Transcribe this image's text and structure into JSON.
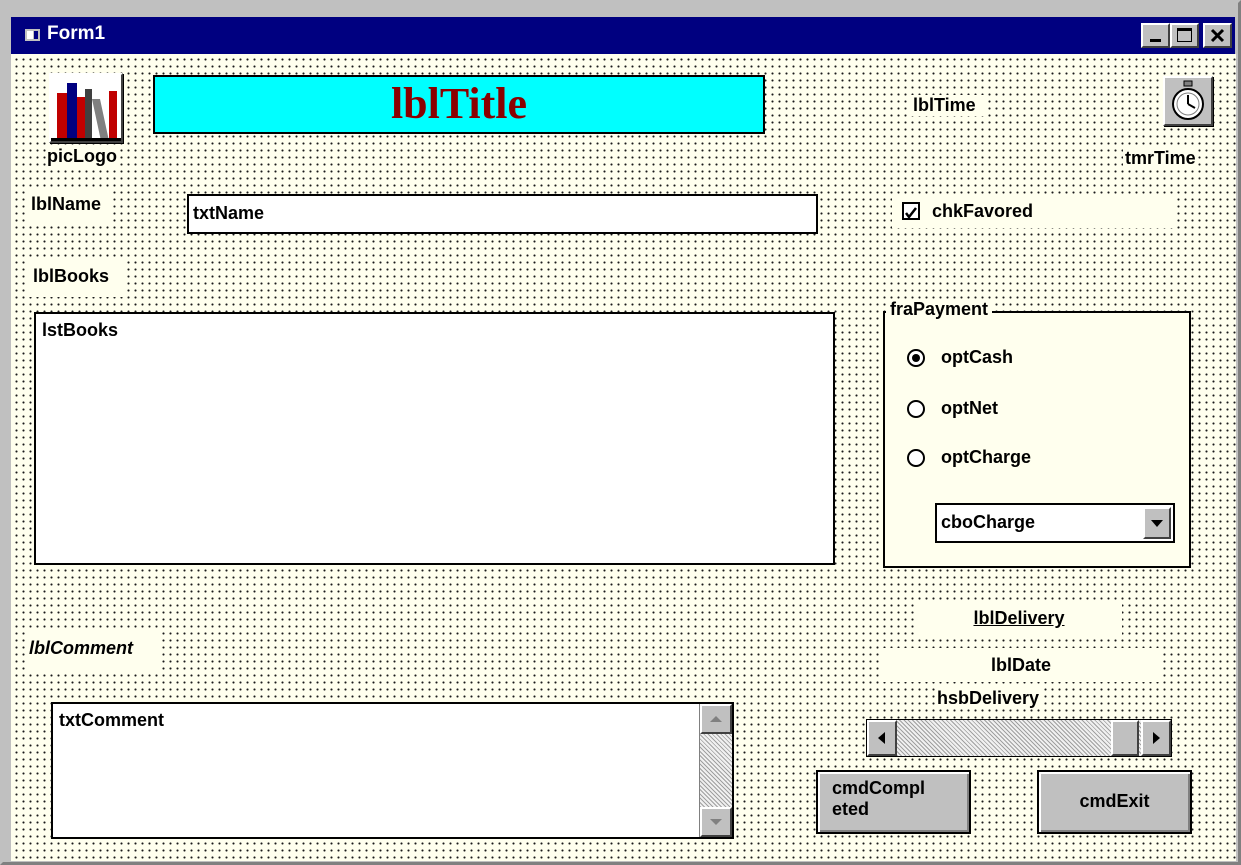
{
  "window": {
    "title": "Form1"
  },
  "controls": {
    "picLogo": "picLogo",
    "lblTitle": "lblTitle",
    "lblTime": "lblTime",
    "tmrTime": "tmrTime",
    "lblName": "lblName",
    "txtName": "txtName",
    "chkFavored": "chkFavored",
    "lblBooks": "lblBooks",
    "lstBooks": "lstBooks",
    "fraPayment": "fraPayment",
    "optCash": "optCash",
    "optNet": "optNet",
    "optCharge": "optCharge",
    "cboCharge": "cboCharge",
    "lblDelivery": "lblDelivery",
    "lblDate": "lblDate",
    "hsbDelivery": "hsbDelivery",
    "lblComment": "lblComment",
    "txtComment": "txtComment",
    "cmdCompleted_line1": "cmdCompl",
    "cmdCompleted_line2": "eted",
    "cmdExit": "cmdExit"
  },
  "state": {
    "chkFavored_checked": true,
    "selected_payment": "optCash"
  },
  "colors": {
    "titlebar": "#000080",
    "form_background": "#ffffee",
    "title_label_background": "#00ffff",
    "title_label_text": "#8b0000"
  },
  "icons": {
    "form_icon": "form-icon",
    "logo": "books-icon",
    "timer": "stopwatch-icon"
  }
}
